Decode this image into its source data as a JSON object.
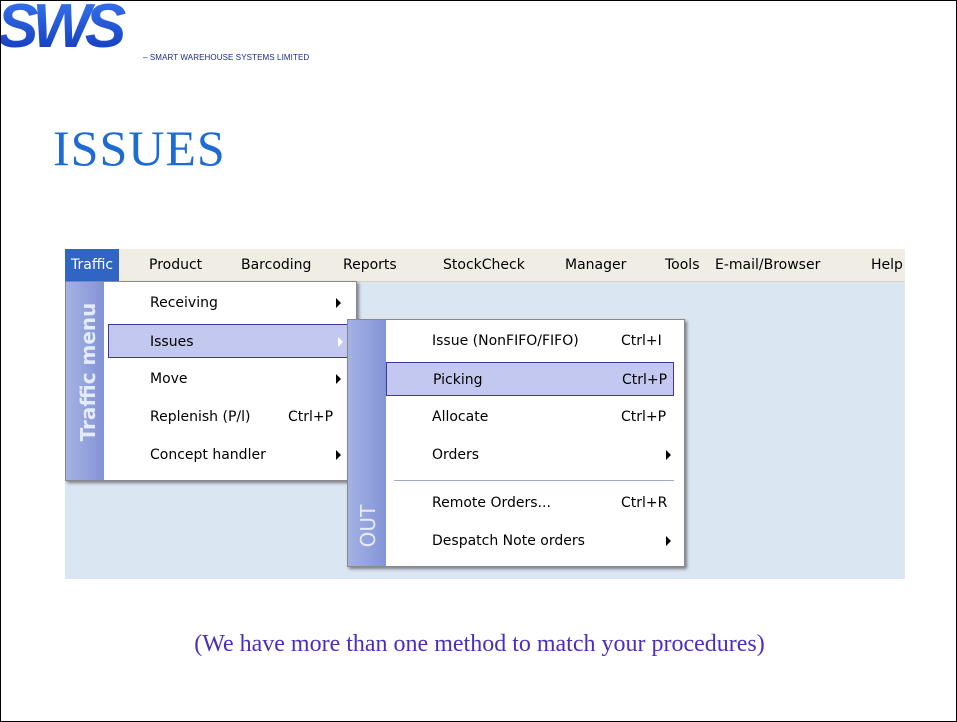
{
  "header": {
    "logo_text": "SWS",
    "company": "– SMART WAREHOUSE SYSTEMS LIMITED",
    "title": "ISSUES"
  },
  "menubar": {
    "items": [
      "Traffic",
      "Product",
      "Barcoding",
      "Reports",
      "StockCheck",
      "Manager",
      "Tools",
      "E-mail/Browser",
      "Help"
    ],
    "active": "Traffic"
  },
  "traffic_menu": {
    "strip_label": "Traffic menu",
    "items": [
      {
        "label": "Receiving",
        "shortcut": "",
        "submenu": true
      },
      {
        "label": "Issues",
        "shortcut": "",
        "submenu": true,
        "highlighted": true
      },
      {
        "label": "Move",
        "shortcut": "",
        "submenu": true
      },
      {
        "label": "Replenish (P/l)",
        "shortcut": "Ctrl+P",
        "submenu": false
      },
      {
        "label": "Concept handler",
        "shortcut": "",
        "submenu": true
      }
    ]
  },
  "issues_menu": {
    "strip_label": "OUT",
    "items": [
      {
        "label": "Issue (NonFIFO/FIFO)",
        "shortcut": "Ctrl+I",
        "submenu": false
      },
      {
        "label": "Picking",
        "shortcut": "Ctrl+P",
        "submenu": false,
        "highlighted": true
      },
      {
        "label": "Allocate",
        "shortcut": "Ctrl+P",
        "submenu": false
      },
      {
        "label": "Orders",
        "shortcut": "",
        "submenu": true
      },
      {
        "label": "Remote Orders...",
        "shortcut": "Ctrl+R",
        "submenu": false
      },
      {
        "label": "Despatch Note orders",
        "shortcut": "",
        "submenu": true
      }
    ]
  },
  "caption": "(We have more than one method to match your procedures)",
  "colors": {
    "title": "#1e6cd2",
    "caption": "#4c2dbf",
    "menubar_active": "#3165c4",
    "menu_highlight": "#c2c8ef",
    "logo": "#1a4fd0"
  }
}
